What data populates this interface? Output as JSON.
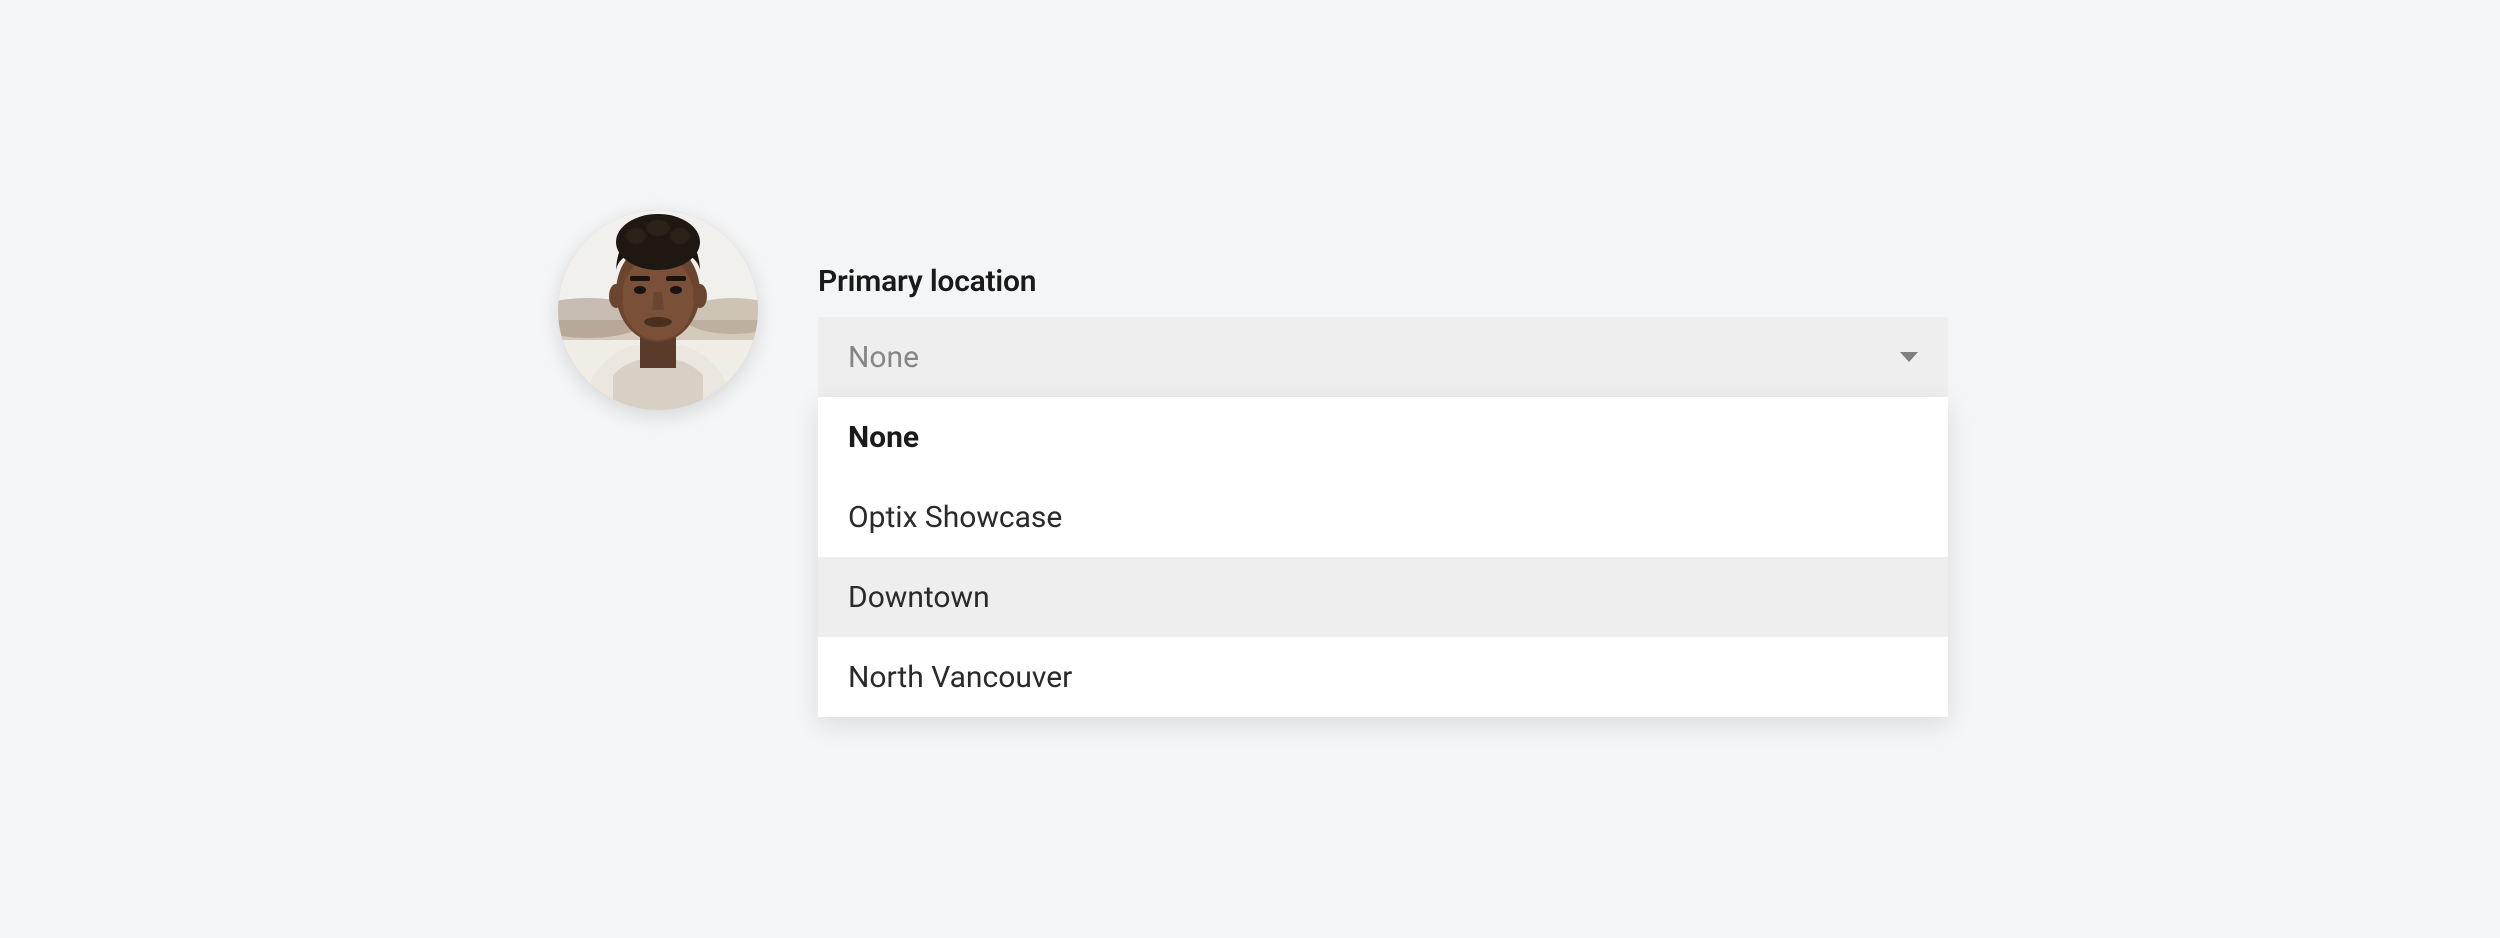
{
  "form": {
    "field_label": "Primary location",
    "selected_value": "None",
    "options": [
      {
        "label": "None",
        "selected": true,
        "hovered": false
      },
      {
        "label": "Optix Showcase",
        "selected": false,
        "hovered": false
      },
      {
        "label": "Downtown",
        "selected": false,
        "hovered": true
      },
      {
        "label": "North Vancouver",
        "selected": false,
        "hovered": false
      }
    ]
  }
}
